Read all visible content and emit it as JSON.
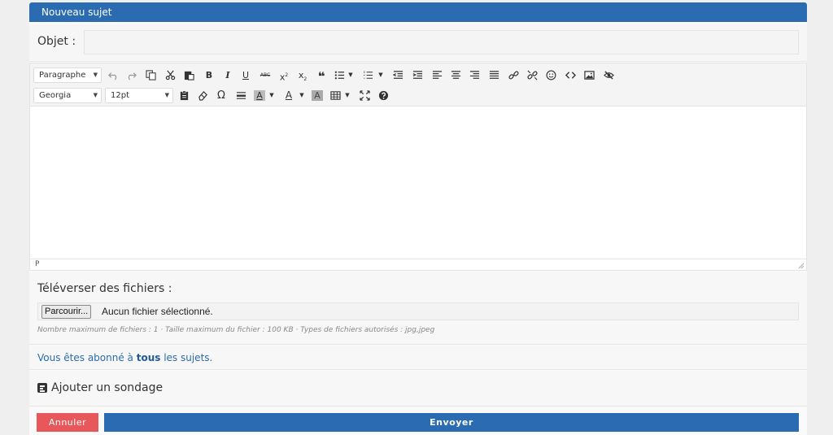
{
  "header": {
    "title": "Nouveau sujet"
  },
  "subject": {
    "label": "Objet :",
    "value": "",
    "placeholder": ""
  },
  "toolbar": {
    "block_format": "Paragraphe",
    "font_family": "Georgia",
    "font_size": "12pt",
    "row1_icons": [
      "undo-icon",
      "redo-icon",
      "copy-icon",
      "cut-icon",
      "paste-icon",
      "bold-icon",
      "italic-icon",
      "underline-icon",
      "strikethrough-icon",
      "superscript-icon",
      "subscript-icon",
      "blockquote-icon",
      "bullet-list-icon",
      "numbered-list-icon",
      "outdent-icon",
      "indent-icon",
      "align-left-icon",
      "align-center-icon",
      "align-right-icon",
      "align-justify-icon",
      "link-icon",
      "unlink-icon",
      "emoticon-icon",
      "code-icon",
      "image-icon",
      "hide-icon"
    ],
    "row2_icons": [
      "paste-text-icon",
      "eraser-icon",
      "omega-icon",
      "horizontal-rule-icon",
      "background-color-icon",
      "text-color-icon",
      "highlight-icon",
      "table-icon",
      "fullscreen-icon",
      "help-icon"
    ],
    "bold_glyph": "B",
    "italic_glyph": "I",
    "underline_glyph": "U",
    "strike_glyph": "ABC",
    "omega_glyph": "Ω",
    "color_glyph": "A"
  },
  "editor": {
    "statusbar_path": "P"
  },
  "upload": {
    "title": "Téléverser des fichiers :",
    "browse_label": "Parcourir...",
    "no_file_text": "Aucun fichier sélectionné.",
    "hint": "Nombre maximum de fichiers : 1 · Taille maximum du fichier : 100 KB · Types de fichiers autorisés : jpg,jpeg"
  },
  "subscription": {
    "prefix": "Vous êtes abonné à ",
    "bold": "tous",
    "suffix": " les sujets."
  },
  "poll": {
    "label": "Ajouter un sondage"
  },
  "actions": {
    "cancel_label": "Annuler",
    "send_label": "Envoyer"
  },
  "colors": {
    "primary": "#2a6bb1",
    "cancel": "#e8585a"
  }
}
